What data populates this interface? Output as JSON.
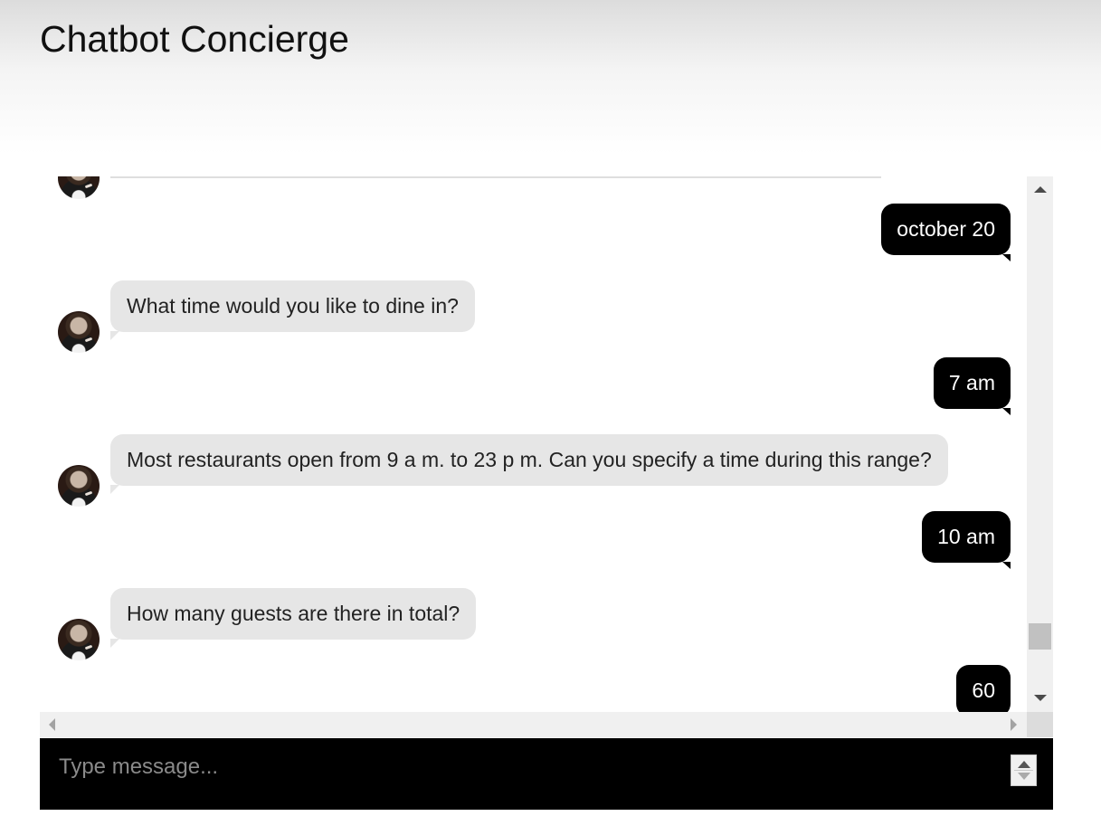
{
  "app": {
    "title": "Chatbot Concierge"
  },
  "conversation": {
    "user_date": "october 20",
    "bot_time_question": "What time would you like to dine in?",
    "user_time_1": "7 am",
    "bot_range_notice": "Most restaurants open from 9 a m. to 23 p m. Can you specify a time during this range?",
    "user_time_2": "10 am",
    "bot_guests_question": "How many guests are there in total?",
    "user_guests": "60"
  },
  "input": {
    "placeholder": "Type message..."
  },
  "icons": {
    "avatar": "concierge-avatar",
    "scroll_up": "triangle-up-icon",
    "scroll_down": "triangle-down-icon",
    "scroll_left": "triangle-left-icon",
    "scroll_right": "triangle-right-icon"
  },
  "colors": {
    "user_bubble": "#000000",
    "bot_bubble": "#e6e6e6",
    "input_bar": "#000000"
  }
}
